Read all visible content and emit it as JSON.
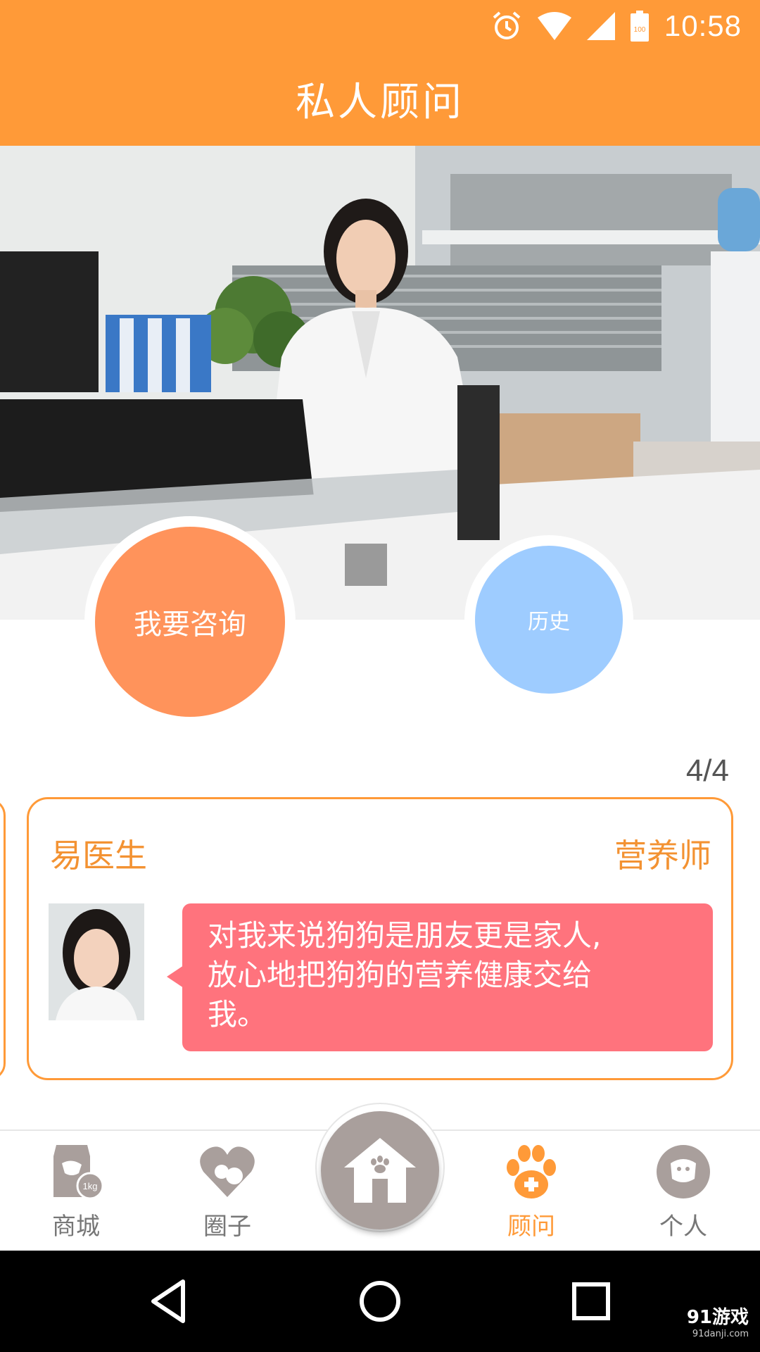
{
  "status_bar": {
    "time": "10:58",
    "battery": "100"
  },
  "header": {
    "title": "私人顾问"
  },
  "actions": {
    "consult_label": "我要咨询",
    "history_label": "历史"
  },
  "pager": {
    "text": "4/4"
  },
  "advisor_card": {
    "name": "易医生",
    "role": "营养师",
    "quote_lines": [
      "对我来说狗狗是朋友更是家人,",
      "放心地把狗狗的营养健康交给",
      "我。"
    ]
  },
  "tabbar": {
    "items": [
      {
        "label": "商城",
        "icon": "pet-food-bag-icon",
        "active": false
      },
      {
        "label": "圈子",
        "icon": "heart-pets-icon",
        "active": false
      },
      {
        "label": "",
        "icon": "home-paw-icon",
        "active": false
      },
      {
        "label": "顾问",
        "icon": "paw-medical-icon",
        "active": true
      },
      {
        "label": "个人",
        "icon": "dog-face-icon",
        "active": false
      }
    ]
  },
  "watermark": {
    "logo": "91游戏",
    "url": "91danji.com"
  },
  "colors": {
    "primary": "#FF9A38",
    "consult": "#FF935B",
    "history": "#9ECCFF",
    "bubble": "#FF737D",
    "inactive": "#A99F9C"
  }
}
